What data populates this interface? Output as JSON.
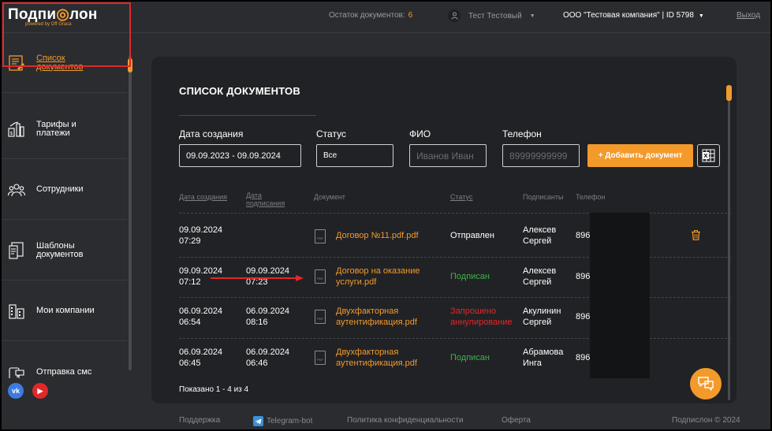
{
  "header": {
    "logo_left": "Подпи",
    "logo_right": "лон",
    "logo_sub": "powered by Off Graca",
    "docs_label": "Остаток документов:",
    "docs_count": "6",
    "user_name": "Тест Тестовый",
    "company": "ООО \"Тестовая компания\" | ID 5798",
    "logout": "Выход"
  },
  "sidebar": {
    "items": [
      {
        "label": "Список документов",
        "icon": "document-list-icon"
      },
      {
        "label": "Тарифы и платежи",
        "icon": "tariffs-icon"
      },
      {
        "label": "Сотрудники",
        "icon": "employees-icon"
      },
      {
        "label": "Шаблоны документов",
        "icon": "templates-icon"
      },
      {
        "label": "Мои компании",
        "icon": "companies-icon"
      },
      {
        "label": "Отправка смс",
        "icon": "sms-icon"
      }
    ],
    "socials": {
      "vk": "vk",
      "youtube": "▶"
    }
  },
  "main": {
    "title": "СПИСОК ДОКУМЕНТОВ",
    "filters": {
      "date_label": "Дата создания",
      "date_value": "09.09.2023 - 09.09.2024",
      "status_label": "Статус",
      "status_value": "Все",
      "fio_label": "ФИО",
      "fio_placeholder": "Иванов Иван",
      "phone_label": "Телефон",
      "phone_placeholder": "89999999999",
      "add_button": "+ Добавить документ"
    },
    "columns": {
      "created": "Дата создания",
      "signed_1": "Дата",
      "signed_2": "подписания",
      "document": "Документ",
      "status": "Статус",
      "signers": "Подписанты",
      "phone": "Телефон"
    },
    "rows": [
      {
        "created_date": "09.09.2024",
        "created_time": "07:29",
        "signed_date": "",
        "signed_time": "",
        "doc_1": "Договор №11.pdf.pdf",
        "doc_2": "",
        "status_1": "Отправлен",
        "status_2": "",
        "signer_1": "Алексев",
        "signer_2": "Сергей",
        "phone": "896"
      },
      {
        "created_date": "09.09.2024",
        "created_time": "07:12",
        "signed_date": "09.09.2024",
        "signed_time": "07:23",
        "doc_1": "Договор на оказание",
        "doc_2": "услуги.pdf",
        "status_1": "Подписан",
        "status_2": "",
        "signer_1": "Алексев",
        "signer_2": "Сергей",
        "phone": "896"
      },
      {
        "created_date": "06.09.2024",
        "created_time": "06:54",
        "signed_date": "06.09.2024",
        "signed_time": "08:16",
        "doc_1": "Двухфакторная",
        "doc_2": "аутентификация.pdf",
        "status_1": "Запрошено",
        "status_2": "аннулирование",
        "signer_1": "Акулинин",
        "signer_2": "Сергей",
        "phone": "896"
      },
      {
        "created_date": "06.09.2024",
        "created_time": "06:45",
        "signed_date": "06.09.2024",
        "signed_time": "06:46",
        "doc_1": "Двухфакторная",
        "doc_2": "аутентификация.pdf",
        "status_1": "Подписан",
        "status_2": "",
        "signer_1": "Абрамова",
        "signer_2": "Инга",
        "phone": "896"
      }
    ],
    "pdf_label": "PDF",
    "showing": "Показано 1 - 4 из 4"
  },
  "footer": {
    "support": "Поддержка",
    "telegram": "Telegram-bot",
    "privacy": "Политика конфиденциальности",
    "offer": "Оферта",
    "copyright": "Подпислон © 2024"
  },
  "colors": {
    "accent": "#f39a2b",
    "signed": "#3eb24a",
    "cancel": "#e0282a"
  }
}
